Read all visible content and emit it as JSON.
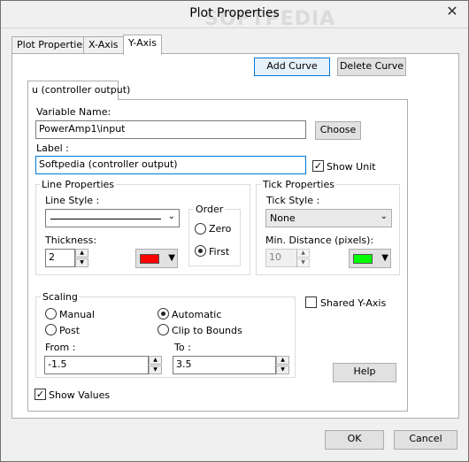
{
  "window": {
    "title": "Plot Properties",
    "close_glyph": "✕",
    "watermark": "SOFTPEDIA"
  },
  "tabs": [
    {
      "label": "Plot Properties"
    },
    {
      "label": "X-Axis"
    },
    {
      "label": "Y-Axis"
    }
  ],
  "curve_buttons": {
    "add": "Add Curve",
    "delete": "Delete Curve"
  },
  "curve_tab": {
    "label": "u (controller output)"
  },
  "variable": {
    "label": "Variable Name:",
    "value": "PowerAmp1\\input",
    "choose": "Choose"
  },
  "label_field": {
    "label": "Label :",
    "value": "Softpedia (controller output)",
    "show_unit": "Show Unit"
  },
  "line_properties": {
    "title": "Line Properties",
    "style_label": "Line Style :",
    "thickness_label": "Thickness:",
    "thickness_value": "2",
    "color": "#ff0000",
    "order": {
      "title": "Order",
      "zero": "Zero",
      "first": "First"
    }
  },
  "tick_properties": {
    "title": "Tick Properties",
    "style_label": "Tick Style :",
    "style_value": "None",
    "min_distance_label": "Min. Distance (pixels):",
    "min_distance_value": "10",
    "color": "#00ff00"
  },
  "shared_y_axis": "Shared Y-Axis",
  "scaling": {
    "title": "Scaling",
    "manual": "Manual",
    "automatic": "Automatic",
    "post": "Post",
    "clip": "Clip to Bounds",
    "from_label": "From :",
    "from_value": "-1.5",
    "to_label": "To :",
    "to_value": "3.5"
  },
  "help": "Help",
  "show_values": "Show Values",
  "footer": {
    "ok": "OK",
    "cancel": "Cancel"
  },
  "glyphs": {
    "check": "✓",
    "arrow_down": "▼",
    "spin_up": "▲",
    "spin_down": "▼",
    "combo_arrow": "⌄"
  }
}
